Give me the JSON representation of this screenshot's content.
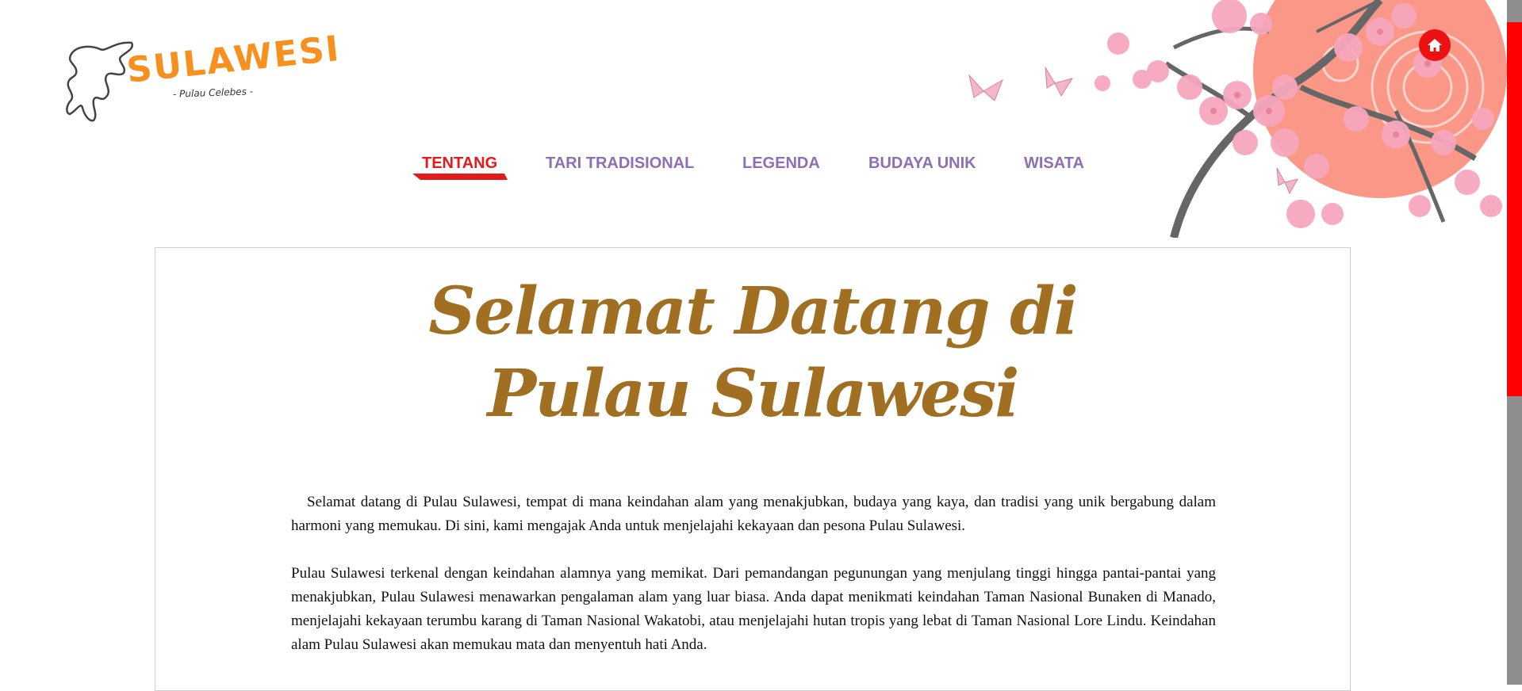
{
  "logo": {
    "title": "SULAWESI",
    "subtitle": "- Pulau Celebes -"
  },
  "nav": {
    "items": [
      {
        "label": "TENTANG",
        "active": true
      },
      {
        "label": "TARI TRADISIONAL",
        "active": false
      },
      {
        "label": "LEGENDA",
        "active": false
      },
      {
        "label": "BUDAYA UNIK",
        "active": false
      },
      {
        "label": "WISATA",
        "active": false
      }
    ]
  },
  "home_button": {
    "icon": "home-icon"
  },
  "main": {
    "title_line1": "Selamat Datang di",
    "title_line2": "Pulau Sulawesi",
    "paragraphs": [
      "Selamat datang di Pulau Sulawesi, tempat di mana keindahan alam yang menakjubkan, budaya yang kaya, dan tradisi yang unik bergabung dalam harmoni yang memukau. Di sini, kami mengajak Anda untuk menjelajahi kekayaan dan pesona Pulau Sulawesi.",
      "Pulau Sulawesi terkenal dengan keindahan alamnya yang memikat. Dari pemandangan pegunungan yang menjulang tinggi hingga pantai-pantai yang menakjubkan, Pulau Sulawesi menawarkan pengalaman alam yang luar biasa. Anda dapat menikmati keindahan Taman Nasional Bunaken di Manado, menjelajahi kekayaan terumbu karang di Taman Nasional Wakatobi, atau menjelajahi hutan tropis yang lebat di Taman Nasional Lore Lindu. Keindahan alam Pulau Sulawesi akan memukau mata dan menyentuh hati Anda."
    ]
  },
  "colors": {
    "accent": "#e31b1b",
    "nav": "#8d6fb3",
    "title": "#a06f22",
    "logo": "#f7901e"
  }
}
